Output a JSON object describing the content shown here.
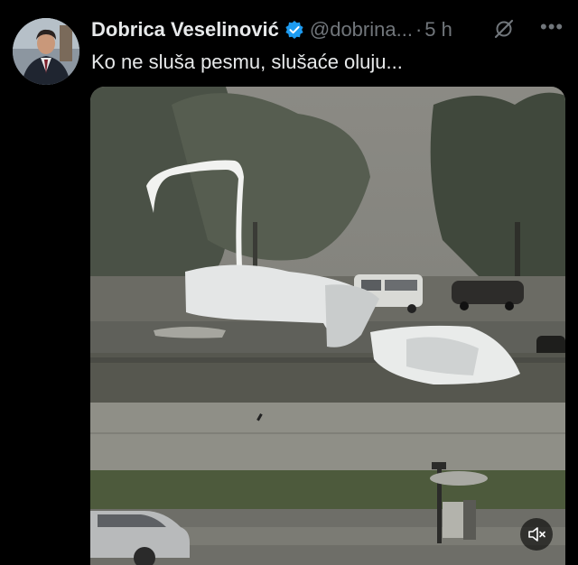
{
  "tweet": {
    "author_name": "Dobrica Veselinović",
    "handle": "@dobrina...",
    "separator": "·",
    "time": "5 h",
    "text": "Ko ne sluša pesmu, slušaće oluju...",
    "more_label": "•••"
  },
  "icons": {
    "verified": "verified-badge-icon",
    "grok": "grok-icon",
    "more": "more-icon",
    "mute": "speaker-muted-icon"
  },
  "colors": {
    "background": "#000000",
    "text": "#e7e9ea",
    "secondary": "#71767b",
    "verified": "#1d9bf0"
  }
}
